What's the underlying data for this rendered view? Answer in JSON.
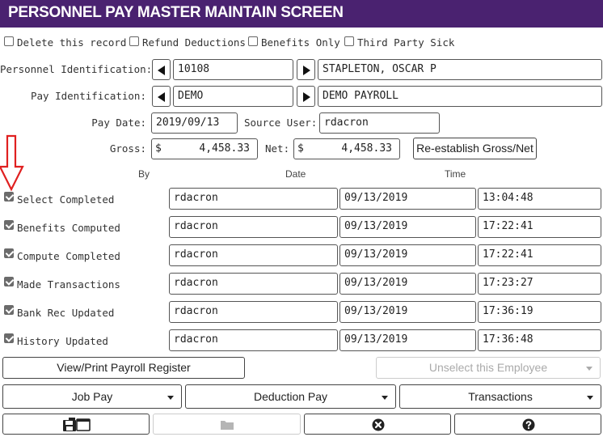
{
  "title": "PERSONNEL PAY MASTER MAINTAIN SCREEN",
  "options": [
    {
      "label": "Delete this record",
      "checked": false
    },
    {
      "label": "Refund Deductions",
      "checked": false
    },
    {
      "label": "Benefits Only",
      "checked": false
    },
    {
      "label": "Third Party Sick",
      "checked": false
    }
  ],
  "personnel": {
    "label": "Personnel Identification:",
    "id": "10108",
    "name": "STAPLETON, OSCAR P"
  },
  "pay": {
    "label": "Pay Identification:",
    "id": "DEMO",
    "name": "DEMO PAYROLL"
  },
  "pay_date": {
    "label": "Pay Date:",
    "value": "2019/09/13"
  },
  "source_user": {
    "label": "Source User:",
    "value": "rdacron"
  },
  "gross": {
    "label": "Gross:",
    "currency": "$",
    "value": "4,458.33"
  },
  "net": {
    "label": "Net:",
    "currency": "$",
    "value": "4,458.33"
  },
  "reestablish_label": "Re-establish Gross/Net",
  "columns": {
    "by": "By",
    "date": "Date",
    "time": "Time"
  },
  "steps": [
    {
      "label": "Select Completed",
      "checked": true,
      "by": "rdacron",
      "date": "09/13/2019",
      "time": "13:04:48"
    },
    {
      "label": "Benefits Computed",
      "checked": true,
      "by": "rdacron",
      "date": "09/13/2019",
      "time": "17:22:41"
    },
    {
      "label": "Compute Completed",
      "checked": true,
      "by": "rdacron",
      "date": "09/13/2019",
      "time": "17:22:41"
    },
    {
      "label": "Made Transactions",
      "checked": true,
      "by": "rdacron",
      "date": "09/13/2019",
      "time": "17:23:27"
    },
    {
      "label": "Bank Rec Updated",
      "checked": true,
      "by": "rdacron",
      "date": "09/13/2019",
      "time": "17:36:19"
    },
    {
      "label": "History Updated",
      "checked": true,
      "by": "rdacron",
      "date": "09/13/2019",
      "time": "17:36:48"
    }
  ],
  "buttons": {
    "view_print": "View/Print Payroll Register",
    "unselect": "Unselect this Employee",
    "job_pay": "Job Pay",
    "deduction_pay": "Deduction Pay",
    "transactions": "Transactions"
  },
  "toolbar_icons": [
    "save-window-icon",
    "folder-icon",
    "cancel-icon",
    "help-icon"
  ],
  "colors": {
    "titlebar": "#4a2270",
    "annotation_arrow": "#e02020"
  }
}
